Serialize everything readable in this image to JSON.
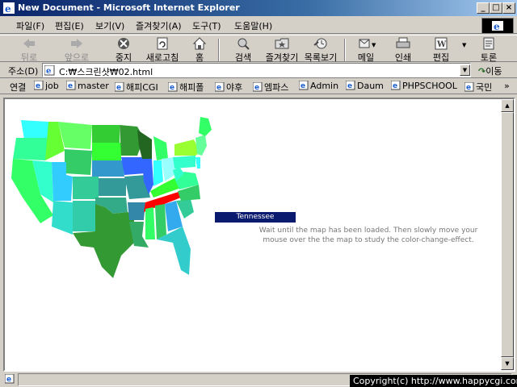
{
  "window": {
    "title": "New Document - Microsoft Internet Explorer",
    "min": "_",
    "max": "□",
    "close": "×"
  },
  "menu": {
    "items": [
      "파일(F)",
      "편집(E)",
      "보기(V)",
      "즐겨찾기(A)",
      "도구(T)",
      "도움말(H)"
    ]
  },
  "toolbar": {
    "back": "뒤로",
    "forward": "앞으로",
    "stop": "중지",
    "refresh": "새로고침",
    "home": "홈",
    "search": "검색",
    "favorites": "즐겨찾기",
    "history": "목록보기",
    "mail": "메일",
    "print": "인쇄",
    "edit": "편집",
    "discuss": "토론"
  },
  "address": {
    "label": "주소(D)",
    "value": "C:₩스크린샷₩02.html",
    "go": "이동"
  },
  "links": {
    "label": "연결",
    "items": [
      "job",
      "master",
      "해피CGI",
      "해피폴",
      "야후",
      "엠파스",
      "Admin",
      "Daum",
      "PHPSCHOOL",
      "국민"
    ],
    "more": "»"
  },
  "content": {
    "state_label": "Tennessee",
    "help_line1": "Wait until the map has been loaded. Then slowly move your",
    "help_line2": "mouse over the the map to study the color-change-effect.",
    "highlight_color": "#ff0000"
  },
  "status": {
    "copyright": "Copyright(c) http://www.happycgi.com"
  },
  "icons": {
    "ie": "ie-page-icon",
    "back": "back-arrow-icon",
    "forward": "forward-arrow-icon"
  }
}
